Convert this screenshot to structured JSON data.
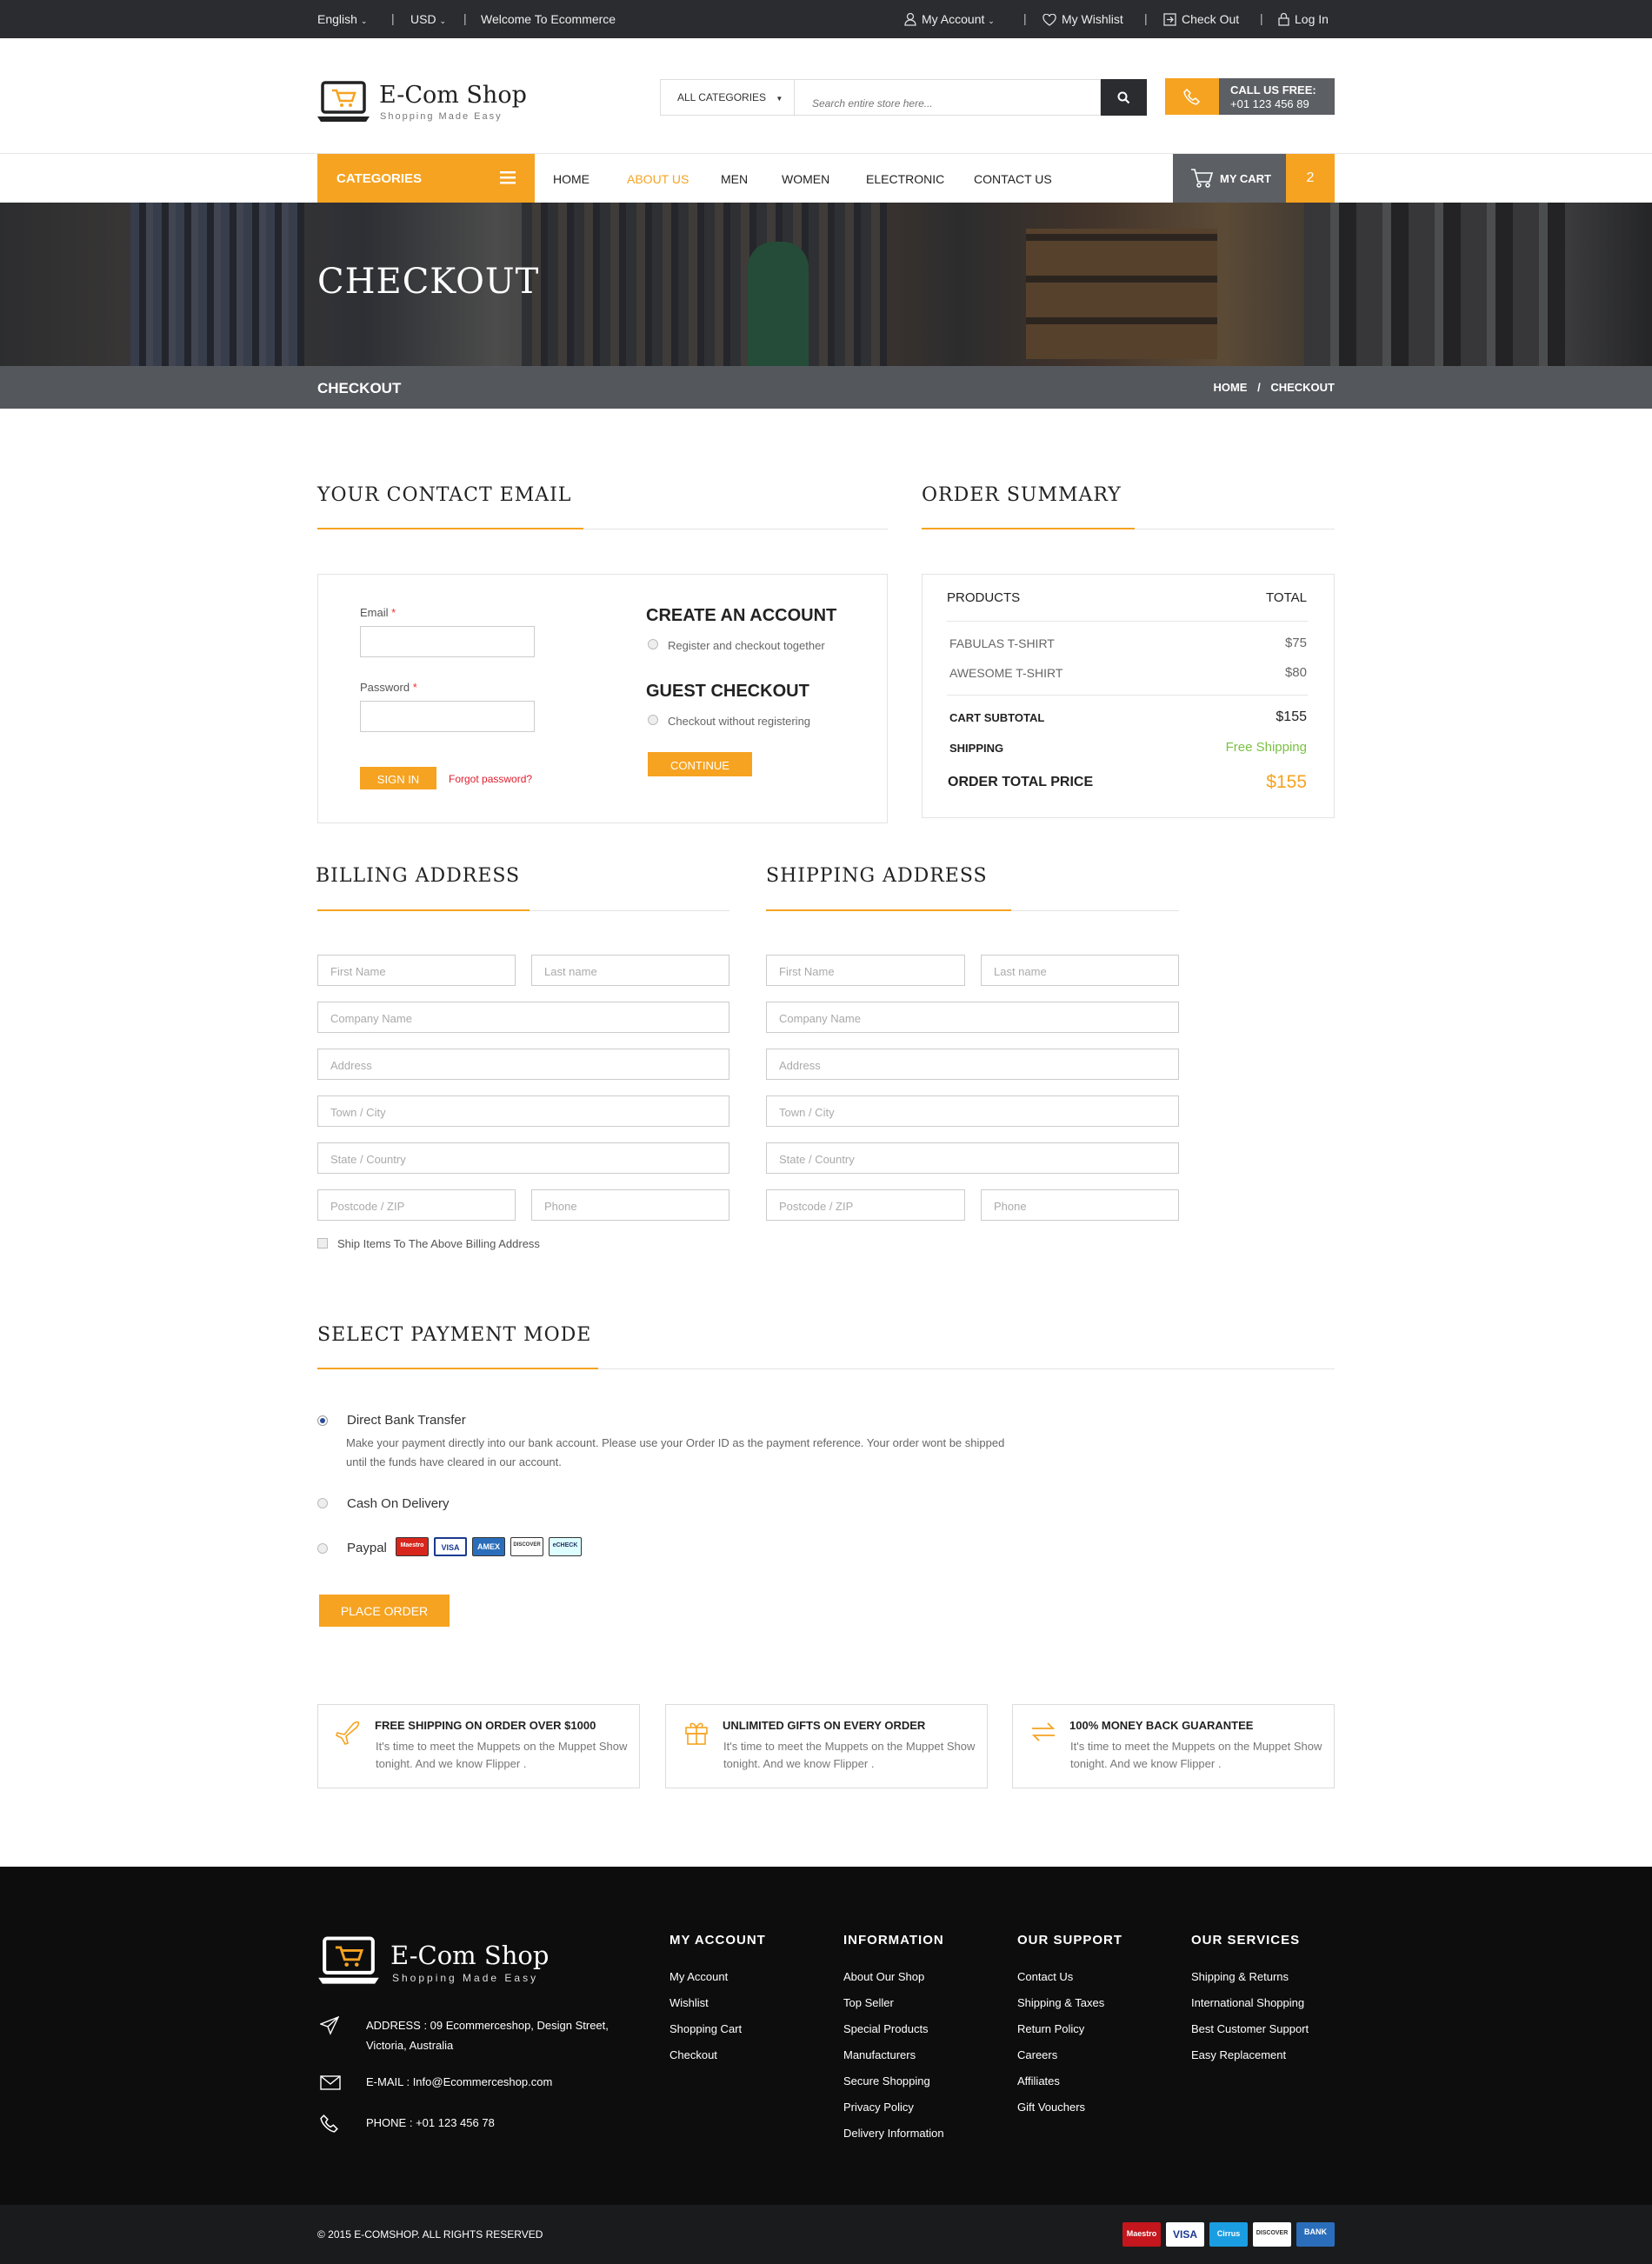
{
  "topbar": {
    "language": "English",
    "currency": "USD",
    "welcome": "Welcome To Ecommerce",
    "account": "My Account",
    "wishlist": "My Wishlist",
    "checkout": "Check Out",
    "login": "Log In"
  },
  "header": {
    "logo_title": "E-Com Shop",
    "logo_tagline": "Shopping Made Easy",
    "category_select": "ALL CATEGORIES",
    "search_placeholder": "Search entire store here...",
    "call_label": "CALL US FREE:",
    "call_number": "+01 123 456 89"
  },
  "nav": {
    "categories": "CATEGORIES",
    "links": [
      "HOME",
      "ABOUT US",
      "MEN",
      "WOMEN",
      "ELECTRONIC",
      "CONTACT US"
    ],
    "cart_label": "MY CART",
    "cart_count": "2"
  },
  "banner": {
    "title": "CHECKOUT",
    "bar_title": "CHECKOUT",
    "crumb_home": "HOME",
    "crumb_sep": "/",
    "crumb_current": "CHECKOUT"
  },
  "contact": {
    "title": "YOUR CONTACT EMAIL",
    "email_label": "Email",
    "password_label": "Password",
    "required": "*",
    "sign_in": "SIGN IN",
    "forgot": "Forgot password?",
    "create_title": "CREATE AN ACCOUNT",
    "create_option": "Register and checkout together",
    "guest_title": "GUEST CHECKOUT",
    "guest_option": "Checkout  without registering",
    "continue": "CONTINUE"
  },
  "summary": {
    "title": "ORDER SUMMARY",
    "col_products": "PRODUCTS",
    "col_total": "TOTAL",
    "items": [
      {
        "name": "FABULAS T-SHIRT",
        "price": "$75"
      },
      {
        "name": "AWESOME T-SHIRT",
        "price": "$80"
      }
    ],
    "subtotal_label": "CART SUBTOTAL",
    "subtotal": "$155",
    "shipping_label": "SHIPPING",
    "shipping": "Free Shipping",
    "total_label": "ORDER TOTAL PRICE",
    "total": "$155"
  },
  "billing": {
    "title": "BILLING ADDRESS",
    "first": "First Name",
    "last": "Last name",
    "company": "Company Name",
    "address": "Address",
    "town": "Town / City",
    "state": "State / Country",
    "post": "Postcode / ZIP",
    "phone": "Phone",
    "ship_same": "Ship Items To The Above Billing Address"
  },
  "shipping": {
    "title": "SHIPPING ADDRESS",
    "first": "First Name",
    "last": "Last name",
    "company": "Company Name",
    "address": "Address",
    "town": "Town / City",
    "state": "State / Country",
    "post": "Postcode / ZIP",
    "phone": "Phone"
  },
  "payment": {
    "title": "SELECT PAYMENT MODE",
    "bank": "Direct Bank Transfer",
    "bank_desc1": "Make your payment directly into our bank account. Please use your Order ID as the payment reference. Your order wont be shipped",
    "bank_desc2": "until the funds have cleared in our account.",
    "cod": "Cash On Delivery",
    "paypal": "Paypal",
    "cards": [
      "Maestro",
      "VISA",
      "AMEX",
      "DISCOVER",
      "eCHECK"
    ],
    "place_order": "PLACE ORDER"
  },
  "features": [
    {
      "title": "FREE SHIPPING ON ORDER OVER $1000",
      "desc": "It's time to meet the Muppets on the Muppet Show tonight. And we know Flipper ."
    },
    {
      "title": "UNLIMITED GIFTS ON EVERY ORDER",
      "desc": "It's time to meet the Muppets on the Muppet Show tonight. And we know Flipper ."
    },
    {
      "title": "100% MONEY BACK GUARANTEE",
      "desc": "It's time to meet the Muppets on the Muppet Show tonight. And we know Flipper ."
    }
  ],
  "footer": {
    "logo_title": "E-Com Shop",
    "logo_tagline": "Shopping Made Easy",
    "address1": "ADDRESS : 09 Ecommerceshop, Design Street,",
    "address2": "Victoria, Australia",
    "email": "E-MAIL : Info@Ecommerceshop.com",
    "phone": "PHONE : +01 123 456 78",
    "col1": {
      "title": "MY ACCOUNT",
      "items": [
        "My Account",
        "Wishlist",
        "Shopping Cart",
        "Checkout"
      ]
    },
    "col2": {
      "title": "INFORMATION",
      "items": [
        "About Our Shop",
        "Top Seller",
        "Special Products",
        "Manufacturers",
        "Secure Shopping",
        "Privacy Policy",
        "Delivery Information"
      ]
    },
    "col3": {
      "title": "OUR SUPPORT",
      "items": [
        "Contact Us",
        "Shipping & Taxes",
        "Return Policy",
        "Careers",
        "Affiliates",
        "Gift Vouchers"
      ]
    },
    "col4": {
      "title": "OUR SERVICES",
      "items": [
        "Shipping & Returns",
        "International Shopping",
        "Best Customer Support",
        "Easy Replacement"
      ]
    },
    "copyright": "© 2015 E-COMSHOP. ALL RIGHTS RESERVED",
    "pay_logos": [
      "Maestro",
      "VISA",
      "Cirrus",
      "DISCOVER",
      "BANK"
    ]
  },
  "colors": {
    "accent": "#f6a321",
    "dark": "#2a2c30",
    "gray": "#5c5f63",
    "green": "#7ac143"
  }
}
